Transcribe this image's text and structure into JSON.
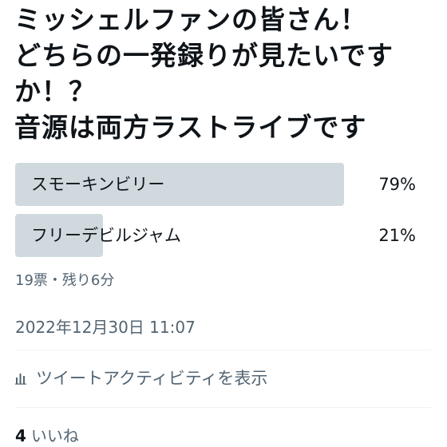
{
  "tweet": {
    "lines": [
      "ミッシェルファンの皆さん！",
      "どちらの一発録りが見たいです",
      "か！？",
      "音源は両方ラストライブです"
    ]
  },
  "poll": {
    "options": [
      {
        "label": "スモーキンビリー",
        "percent_text": "79%",
        "share": 0.79,
        "leading": true
      },
      {
        "label": "フリーデビルジャム",
        "percent_text": "21%",
        "share": 0.21,
        "leading": false
      }
    ],
    "meta": "19票・残り6分"
  },
  "timestamp": "2022年12月30日 11:07",
  "activity": {
    "icon": "bar-chart-icon",
    "label": "ツイートアクティビティを表示"
  },
  "likes": {
    "count": "4",
    "label": "いいね"
  },
  "colors": {
    "bar": "#cfd9de",
    "secondary_text": "#536471",
    "primary_text": "#0f1419"
  }
}
